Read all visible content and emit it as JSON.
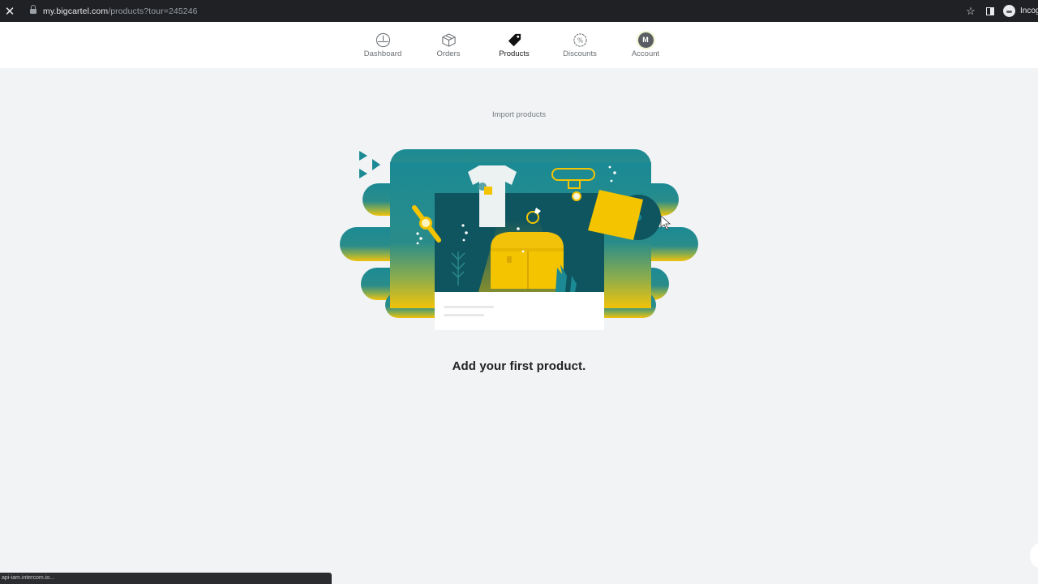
{
  "browser": {
    "close_icon": "close-icon",
    "url_domain": "my.bigcartel.com",
    "url_path": "/products?tour=245246",
    "incognito_label": "Incognito",
    "status_text": "api-iam.intercom.io..."
  },
  "nav": {
    "items": [
      {
        "label": "Dashboard",
        "icon": "dashboard-gauge-icon",
        "active": false
      },
      {
        "label": "Orders",
        "icon": "box-icon",
        "active": false
      },
      {
        "label": "Products",
        "icon": "tag-icon",
        "active": true
      },
      {
        "label": "Discounts",
        "icon": "percent-badge-icon",
        "active": false
      },
      {
        "label": "Account",
        "icon": "avatar",
        "avatar_initial": "M",
        "active": false
      }
    ]
  },
  "main": {
    "import_link": "Import products",
    "headline": "Add your first product."
  },
  "colors": {
    "teal": "#1b8a94",
    "dark_teal": "#0f5560",
    "yellow": "#f5c400",
    "background": "#f1f3f5"
  }
}
